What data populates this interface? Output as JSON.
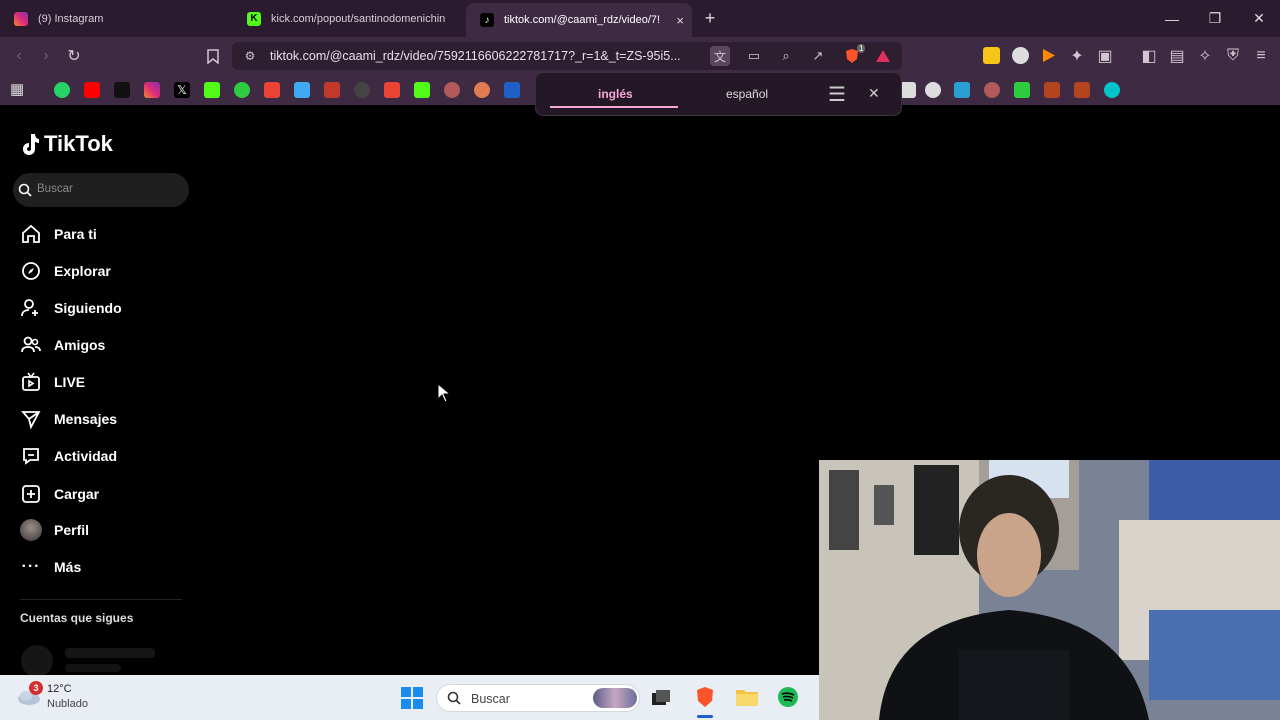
{
  "browser": {
    "tabs": [
      {
        "title": "(9) Instagram",
        "active": false,
        "favicon": "instagram-icon"
      },
      {
        "title": "kick.com/popout/santinodomenichin",
        "active": false,
        "favicon": "kick-icon"
      },
      {
        "title": "tiktok.com/@caami_rdz/video/7!",
        "active": true,
        "favicon": "tiktok-icon",
        "close": "×"
      }
    ],
    "new_tab": "+",
    "window_controls": {
      "minimize": "—",
      "maximize": "❐",
      "close": "✕"
    },
    "url": "tiktok.com/@caami_rdz/video/7592116606222781717?_r=1&_t=ZS-95i5...",
    "shields_count": "1"
  },
  "translate_popup": {
    "source_lang": "inglés",
    "target_lang": "español",
    "menu": "☰",
    "close": "✕"
  },
  "tiktok": {
    "logo": "TikTok",
    "search_placeholder": "Buscar",
    "nav": [
      {
        "label": "Para ti",
        "icon": "home-icon"
      },
      {
        "label": "Explorar",
        "icon": "compass-icon"
      },
      {
        "label": "Siguiendo",
        "icon": "user-plus-icon"
      },
      {
        "label": "Amigos",
        "icon": "friends-icon"
      },
      {
        "label": "LIVE",
        "icon": "live-tv-icon"
      },
      {
        "label": "Mensajes",
        "icon": "send-icon"
      },
      {
        "label": "Actividad",
        "icon": "activity-icon"
      },
      {
        "label": "Cargar",
        "icon": "upload-icon"
      },
      {
        "label": "Perfil",
        "icon": "avatar"
      },
      {
        "label": "Más",
        "icon": "more-icon"
      }
    ],
    "following_heading": "Cuentas que sigues"
  },
  "taskbar": {
    "weather_temp": "12°C",
    "weather_desc": "Nublado",
    "weather_badge": "3",
    "search_placeholder": "Buscar"
  },
  "colors": {
    "tabstrip": "#2b1b2e",
    "toolbar": "#3f2a43",
    "translate_accent": "#f7a8d8",
    "page_bg": "#000000"
  }
}
